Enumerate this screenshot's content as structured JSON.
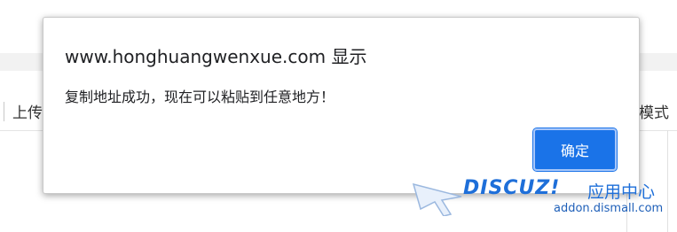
{
  "background": {
    "upload_label": "上传",
    "mode_label": "模式"
  },
  "dialog": {
    "title": "www.honghuangwenxue.com 显示",
    "message": "复制地址成功，现在可以粘贴到任意地方！",
    "ok_label": "确定"
  },
  "watermark": {
    "brand": "DISCUZ!",
    "center": "应用中心",
    "domain": "addon.dismall.com"
  },
  "colors": {
    "accent": "#1a73e8",
    "watermark": "#1e6fd9"
  }
}
